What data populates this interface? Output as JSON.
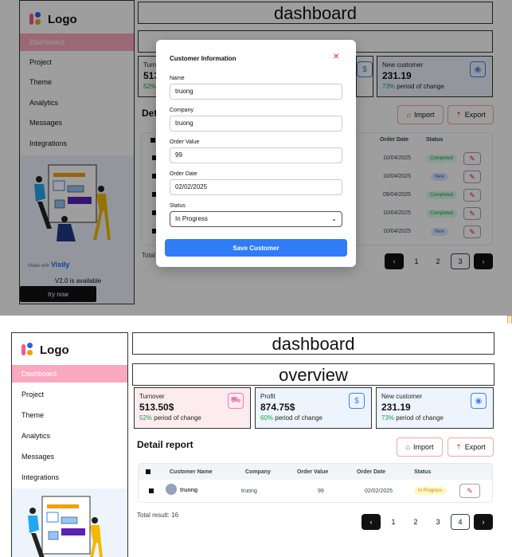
{
  "brand": {
    "logo_text": "Logo"
  },
  "nav": {
    "items": [
      {
        "label": "Dashboard",
        "active": true
      },
      {
        "label": "Project"
      },
      {
        "label": "Theme"
      },
      {
        "label": "Analytics"
      },
      {
        "label": "Messages"
      },
      {
        "label": "Integrations"
      }
    ]
  },
  "promo": {
    "made_with": "Made with",
    "visily": "Visily",
    "version": "V2.0 is available",
    "try_now": "try now"
  },
  "header": {
    "dashboard": "dashboard",
    "overview": "overview"
  },
  "cards": [
    {
      "title": "Turnover",
      "value": "513.50$",
      "pct": "52%",
      "change": "period of change",
      "icon": "cart-icon",
      "bg": "#fdecef",
      "icon_color": "#f472b6"
    },
    {
      "title": "Profit",
      "value": "874.75$",
      "pct": "60%",
      "change": "period of change",
      "icon": "dollar-icon",
      "bg": "#eef4fd",
      "icon_color": "#3b82f6"
    },
    {
      "title": "New customer",
      "value": "231.19",
      "pct": "73%",
      "change": "period of change",
      "icon": "user-circle-icon",
      "bg": "#eef4fd",
      "icon_color": "#3b82f6"
    }
  ],
  "report": {
    "title": "Detail report",
    "import_label": "Import",
    "export_label": "Export",
    "columns": [
      "Customer Name",
      "Company",
      "Order Value",
      "Order Date",
      "Status"
    ],
    "rows_top": [
      {
        "date": "10/04/2025",
        "status": "Completed"
      },
      {
        "date": "10/04/2025",
        "status": "New"
      },
      {
        "date": "09/04/2025",
        "status": "Completed"
      },
      {
        "date": "10/04/2025",
        "status": "Completed"
      },
      {
        "date": "10/04/2025",
        "status": "New"
      }
    ],
    "row_bottom": {
      "name": "truong",
      "company": "truong",
      "value": "99",
      "date": "02/02/2025",
      "status": "In Progress"
    },
    "total_top": "Total",
    "total_bottom": "Total result: 16",
    "pages_top": [
      "1",
      "2",
      "3"
    ],
    "pages_bottom": [
      "1",
      "2",
      "3",
      "4"
    ],
    "prev": "‹",
    "next": "›"
  },
  "modal": {
    "title": "Customer Information",
    "name_label": "Name",
    "name_value": "truong",
    "company_label": "Company",
    "company_value": "truong",
    "order_value_label": "Order Value",
    "order_value_value": "99",
    "order_date_label": "Order Date",
    "order_date_value": "02/02/2025",
    "status_label": "Status",
    "status_value": "In Progress",
    "save_label": "Save Customer"
  },
  "colors": {
    "accent": "#2f7cf6",
    "active_nav": "#f9a8c0",
    "positive": "#16a34a",
    "danger": "#e11d48"
  }
}
